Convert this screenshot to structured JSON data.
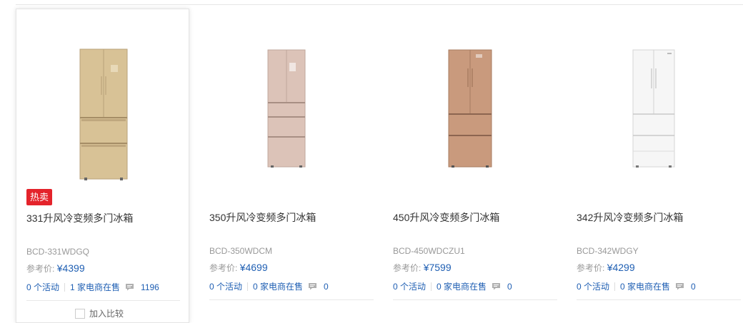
{
  "products": [
    {
      "badge": "热卖",
      "title": "331升风冷变频多门冰箱",
      "model": "BCD-331WDGQ",
      "price_label": "参考价:",
      "price": "¥4399",
      "activity": "0 个活动",
      "dealers": "1 家电商在售",
      "comments": "1196",
      "compare": "加入比较",
      "fridge_color": "#d9c49a",
      "active": true
    },
    {
      "badge": "",
      "title": "350升风冷变频多门冰箱",
      "model": "BCD-350WDCM",
      "price_label": "参考价:",
      "price": "¥4699",
      "activity": "0 个活动",
      "dealers": "0 家电商在售",
      "comments": "0",
      "fridge_color": "#d9bfb4",
      "active": false
    },
    {
      "badge": "",
      "title": "450升风冷变频多门冰箱",
      "model": "BCD-450WDCZU1",
      "price_label": "参考价:",
      "price": "¥7599",
      "activity": "0 个活动",
      "dealers": "0 家电商在售",
      "comments": "0",
      "fridge_color": "#c99b7f",
      "active": false
    },
    {
      "badge": "",
      "title": "342升风冷变频多门冰箱",
      "model": "BCD-342WDGY",
      "price_label": "参考价:",
      "price": "¥4299",
      "activity": "0 个活动",
      "dealers": "0 家电商在售",
      "comments": "0",
      "fridge_color": "#f4f4f4",
      "active": false
    }
  ]
}
